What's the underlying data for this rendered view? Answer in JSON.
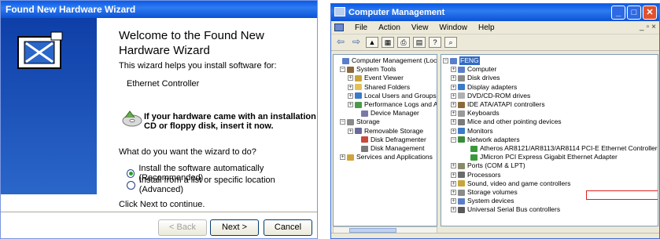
{
  "wizard": {
    "title": "Found New Hardware Wizard",
    "heading": "Welcome to the Found New Hardware Wizard",
    "intro": "This wizard helps you install software for:",
    "device": "Ethernet Controller",
    "cd_prompt": "If your hardware came with an installation CD or floppy disk, insert it now.",
    "question": "What do you want the wizard to do?",
    "options": [
      {
        "label": "Install the software automatically (Recommended)",
        "selected": true
      },
      {
        "label": "Install from a list or specific location (Advanced)",
        "selected": false
      }
    ],
    "continue_hint": "Click Next to continue.",
    "buttons": {
      "back": "< Back",
      "next": "Next >",
      "cancel": "Cancel"
    },
    "colors": {
      "title_bar": "#0a5ae6",
      "side_panel": "#1b4fb6"
    }
  },
  "cm": {
    "title": "Computer Management",
    "menu": [
      "File",
      "Action",
      "View",
      "Window",
      "Help"
    ],
    "left_tree": [
      {
        "label": "Computer Management (Local)",
        "exp": "",
        "icon": "computer-icon",
        "color": "#5a7fc8"
      },
      {
        "label": "System Tools",
        "exp": "−",
        "icon": "tools-icon",
        "color": "#8a6a3a"
      },
      {
        "label": "Event Viewer",
        "exp": "+",
        "icon": "event-viewer-icon",
        "color": "#c8a43a"
      },
      {
        "label": "Shared Folders",
        "exp": "+",
        "icon": "shared-folders-icon",
        "color": "#e2c15a"
      },
      {
        "label": "Local Users and Groups",
        "exp": "+",
        "icon": "users-icon",
        "color": "#3a7ac8"
      },
      {
        "label": "Performance Logs and Alerts",
        "exp": "+",
        "icon": "performance-icon",
        "color": "#4a9a4a"
      },
      {
        "label": "Device Manager",
        "exp": "",
        "icon": "device-manager-icon",
        "color": "#7a7aa8"
      },
      {
        "label": "Storage",
        "exp": "−",
        "icon": "storage-icon",
        "color": "#8a8a8a"
      },
      {
        "label": "Removable Storage",
        "exp": "+",
        "icon": "removable-storage-icon",
        "color": "#6a6a9a"
      },
      {
        "label": "Disk Defragmenter",
        "exp": "",
        "icon": "defrag-icon",
        "color": "#c84a3a"
      },
      {
        "label": "Disk Management",
        "exp": "",
        "icon": "disk-management-icon",
        "color": "#7a7a7a"
      },
      {
        "label": "Services and Applications",
        "exp": "+",
        "icon": "services-icon",
        "color": "#d2a23a"
      }
    ],
    "right_tree": [
      {
        "label": "FENG",
        "exp": "−",
        "icon": "computer-icon",
        "color": "#5a7fc8",
        "highlight": true
      },
      {
        "label": "Computer",
        "exp": "+",
        "icon": "computer-icon",
        "color": "#5a7fc8"
      },
      {
        "label": "Disk drives",
        "exp": "+",
        "icon": "disk-drive-icon",
        "color": "#8a8a8a"
      },
      {
        "label": "Display adapters",
        "exp": "+",
        "icon": "display-icon",
        "color": "#3a7ac8"
      },
      {
        "label": "DVD/CD-ROM drives",
        "exp": "+",
        "icon": "dvd-icon",
        "color": "#b0b0b0"
      },
      {
        "label": "IDE ATA/ATAPI controllers",
        "exp": "+",
        "icon": "ide-icon",
        "color": "#8a6a3a"
      },
      {
        "label": "Keyboards",
        "exp": "+",
        "icon": "keyboard-icon",
        "color": "#9a9a9a"
      },
      {
        "label": "Mice and other pointing devices",
        "exp": "+",
        "icon": "mouse-icon",
        "color": "#7a7a7a"
      },
      {
        "label": "Monitors",
        "exp": "+",
        "icon": "monitor-icon",
        "color": "#3a7ac8"
      },
      {
        "label": "Network adapters",
        "exp": "−",
        "icon": "network-icon",
        "color": "#3a8a3a"
      },
      {
        "label": "Atheros AR8121/AR8113/AR8114 PCI-E Ethernet Controller",
        "exp": "",
        "icon": "network-card-icon",
        "color": "#3a9a3a"
      },
      {
        "label": "JMicron PCI Express Gigabit Ethernet Adapter",
        "exp": "",
        "icon": "network-card-icon",
        "color": "#3a9a3a"
      },
      {
        "label": "Ports (COM & LPT)",
        "exp": "+",
        "icon": "port-icon",
        "color": "#8a8a6a"
      },
      {
        "label": "Processors",
        "exp": "+",
        "icon": "processor-icon",
        "color": "#6a6a6a"
      },
      {
        "label": "Sound, video and game controllers",
        "exp": "+",
        "icon": "sound-icon",
        "color": "#c8a43a"
      },
      {
        "label": "Storage volumes",
        "exp": "+",
        "icon": "storage-volume-icon",
        "color": "#8a8a8a"
      },
      {
        "label": "System devices",
        "exp": "+",
        "icon": "system-devices-icon",
        "color": "#5a7fc8"
      },
      {
        "label": "Universal Serial Bus controllers",
        "exp": "+",
        "icon": "usb-icon",
        "color": "#5a5a5a"
      }
    ]
  }
}
